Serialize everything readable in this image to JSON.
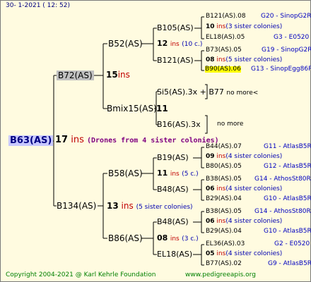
{
  "header": {
    "date": "30- 1-2021 ( 12: 52)"
  },
  "footer": {
    "copyright": "Copyright 2004-2021 @ Karl Kehrle Foundation",
    "website": "www.pedigreeapis.org"
  },
  "root": {
    "name": "B63(AS)",
    "count": "17",
    "ins": "ins",
    "note": "(Drones from 4 sister colonies)"
  },
  "gen1": {
    "top": {
      "name": "B72(AS)",
      "count": "15",
      "ins": "ins"
    },
    "bottom": {
      "name": "B134(AS)",
      "count": "13",
      "ins": "ins",
      "note": "(5 sister colonies)"
    }
  },
  "gen2": {
    "b52": {
      "name": "B52(AS)"
    },
    "bmix": {
      "name": "Bmix15(AS)",
      "count": "11"
    },
    "b58": {
      "name": "B58(AS)"
    },
    "b86": {
      "name": "B86(AS)"
    }
  },
  "gen3": {
    "b105": {
      "name": "B105(AS)",
      "count": "12",
      "ins": "ins",
      "note": "(10 c.)"
    },
    "b121": {
      "name": "B121(AS)"
    },
    "si5": {
      "name": "Si5(AS).3x + B77",
      "note": "no more<"
    },
    "b16": {
      "name": "B16(AS).3x",
      "note": "no more"
    },
    "b19": {
      "name": "B19(AS)",
      "count": "11",
      "ins": "ins",
      "note": "(5 c.)"
    },
    "b48a": {
      "name": "B48(AS)"
    },
    "b48b": {
      "name": "B48(AS)",
      "count": "08",
      "ins": "ins",
      "note": "(3 c.)"
    },
    "el18": {
      "name": "EL18(AS)"
    }
  },
  "leaves": [
    {
      "name": "B121(AS).08",
      "code": "G20 - SinopG2R"
    },
    {
      "name": "10",
      "ins": "ins",
      "note": "(3 sister colonies)"
    },
    {
      "name": "EL18(AS).05",
      "code": "G3 - E0520"
    },
    {
      "name": "B73(AS).05",
      "code": "G19 - SinopG2R"
    },
    {
      "name": "08",
      "ins": "ins",
      "note": "(5 sister colonies)"
    },
    {
      "name": "B90(AS).06",
      "code": "G13 - SinopEgg86R"
    },
    {
      "name": "B44(AS).07",
      "code": "G11 - AtlasB5R"
    },
    {
      "name": "09",
      "ins": "ins",
      "note": "(4 sister colonies)"
    },
    {
      "name": "B80(AS).05",
      "code": "G12 - AtlasB5R"
    },
    {
      "name": "B38(AS).05",
      "code": "G14 - AthosSt80R"
    },
    {
      "name": "06",
      "ins": "ins",
      "note": "(4 sister colonies)"
    },
    {
      "name": "B29(AS).04",
      "code": "G10 - AtlasB5R"
    },
    {
      "name": "B38(AS).05",
      "code": "G14 - AthosSt80R"
    },
    {
      "name": "06",
      "ins": "ins",
      "note": "(4 sister colonies)"
    },
    {
      "name": "B29(AS).04",
      "code": "G10 - AtlasB5R"
    },
    {
      "name": "EL36(AS).03",
      "code": "G2 - E0520"
    },
    {
      "name": "05",
      "ins": "ins",
      "note": "(4 sister colonies)"
    },
    {
      "name": "B77(AS).02",
      "code": "G9 - AtlasB5R"
    }
  ]
}
